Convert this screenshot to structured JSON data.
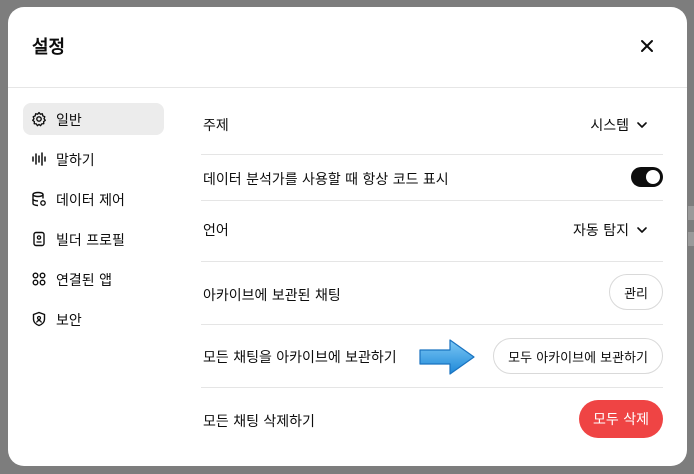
{
  "dialog": {
    "title": "설정",
    "close_icon": "close-icon"
  },
  "sidebar": {
    "items": [
      {
        "label": "일반",
        "icon": "gear-icon",
        "active": true
      },
      {
        "label": "말하기",
        "icon": "waveform-icon",
        "active": false
      },
      {
        "label": "데이터 제어",
        "icon": "database-icon",
        "active": false
      },
      {
        "label": "빌더 프로필",
        "icon": "id-card-icon",
        "active": false
      },
      {
        "label": "연결된 앱",
        "icon": "apps-grid-icon",
        "active": false
      },
      {
        "label": "보안",
        "icon": "shield-icon",
        "active": false
      }
    ]
  },
  "settings": {
    "theme": {
      "label": "주제",
      "value": "시스템"
    },
    "show_code": {
      "label": "데이터 분석가를 사용할 때 항상 코드 표시",
      "enabled": true
    },
    "language": {
      "label": "언어",
      "value": "자동 탐지"
    },
    "archived": {
      "label": "아카이브에 보관된 채팅",
      "button": "관리"
    },
    "archive_all": {
      "label": "모든 채팅을 아카이브에 보관하기",
      "button": "모두 아카이브에 보관하기"
    },
    "delete_all": {
      "label": "모든 채팅 삭제하기",
      "button": "모두 삭제"
    }
  },
  "colors": {
    "danger": "#ef4444",
    "toggle_on": "#0d0d0d",
    "sidebar_active": "#ececec",
    "annotation_arrow": "#3aa3e8"
  },
  "annotation": {
    "icon": "blue-arrow-icon"
  }
}
